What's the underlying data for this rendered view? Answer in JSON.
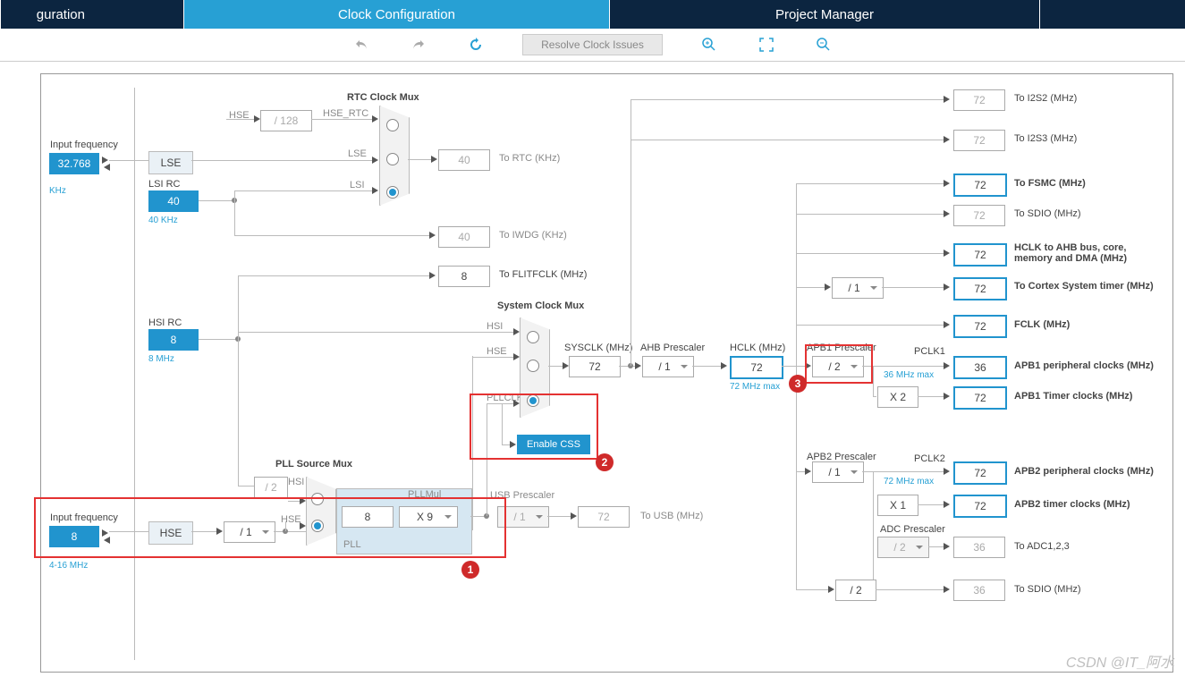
{
  "tabs": {
    "config": "guration",
    "clock": "Clock Configuration",
    "pm": "Project Manager"
  },
  "toolbar": {
    "resolve": "Resolve Clock Issues"
  },
  "left": {
    "lse_freq_label": "Input frequency",
    "lse_freq": "32.768",
    "lse_unit": "KHz",
    "lsi_rc_label": "LSI RC",
    "lsi_val": "40",
    "lsi_unit": "40 KHz",
    "hsi_rc_label": "HSI RC",
    "hsi_val": "8",
    "hsi_unit": "8 MHz",
    "hse_freq_label": "Input frequency",
    "hse_freq": "8",
    "hse_range": "4-16 MHz",
    "lse": "LSE",
    "hse": "HSE",
    "hse_sig": "HSE",
    "lse_sig": "LSE",
    "lsi_sig": "LSI",
    "hse_div": "/ 128",
    "hse_rtc": "HSE_RTC"
  },
  "rtc": {
    "mux_label": "RTC Clock Mux",
    "to_rtc": "To RTC (KHz)",
    "rtc_val": "40",
    "iwdg_val": "40",
    "to_iwdg": "To IWDG (KHz)"
  },
  "flit": {
    "val": "8",
    "label": "To FLITFCLK (MHz)"
  },
  "pll": {
    "src_mux": "PLL Source Mux",
    "div2": "/ 2",
    "hsi": "HSI",
    "hse": "HSE",
    "pre": "/ 1",
    "freq": "8",
    "mul_lbl": "PLLMul",
    "mul": "X 9",
    "pll_lbl": "PLL"
  },
  "sys": {
    "mux_label": "System Clock Mux",
    "hsi": "HSI",
    "hse": "HSE",
    "pllclk": "PLLCLK",
    "css": "Enable CSS",
    "sysclk_lbl": "SYSCLK (MHz)",
    "sysclk": "72",
    "ahb_lbl": "AHB Prescaler",
    "ahb": "/ 1",
    "hclk_lbl": "HCLK (MHz)",
    "hclk": "72",
    "hclk_note": "72 MHz max"
  },
  "usb": {
    "lbl": "USB Prescaler",
    "pre": "/ 1",
    "val": "72",
    "to": "To USB (MHz)"
  },
  "right": {
    "i2s2": {
      "v": "72",
      "l": "To I2S2 (MHz)"
    },
    "i2s3": {
      "v": "72",
      "l": "To I2S3 (MHz)"
    },
    "fsmc": {
      "v": "72",
      "l": "To FSMC (MHz)"
    },
    "sdio1": {
      "v": "72",
      "l": "To SDIO (MHz)"
    },
    "hclk_bus": {
      "v": "72",
      "l": "HCLK to AHB bus, core, memory and DMA (MHz)"
    },
    "cortex_div": "/ 1",
    "cortex": {
      "v": "72",
      "l": "To Cortex System timer (MHz)"
    },
    "fclk": {
      "v": "72",
      "l": "FCLK (MHz)"
    },
    "apb1": {
      "lbl": "APB1 Prescaler",
      "pre": "/ 2",
      "pclk1": "PCLK1",
      "pclk1_note": "36 MHz max",
      "v": "36",
      "l": "APB1 peripheral clocks (MHz)",
      "x2": "X 2",
      "timer_v": "72",
      "timer_l": "APB1 Timer clocks (MHz)"
    },
    "apb2": {
      "lbl": "APB2 Prescaler",
      "pre": "/ 1",
      "pclk2": "PCLK2",
      "pclk2_note": "72 MHz max",
      "v": "72",
      "l": "APB2 peripheral clocks (MHz)",
      "x1": "X 1",
      "timer_v": "72",
      "timer_l": "APB2 timer clocks (MHz)"
    },
    "adc": {
      "lbl": "ADC Prescaler",
      "pre": "/ 2",
      "v": "36",
      "l": "To ADC1,2,3"
    },
    "sdio2": {
      "pre": "/ 2",
      "v": "36",
      "l": "To SDIO (MHz)"
    }
  },
  "ann": {
    "m1": "1",
    "m2": "2",
    "m3": "3"
  },
  "watermark": "CSDN @IT_阿水"
}
